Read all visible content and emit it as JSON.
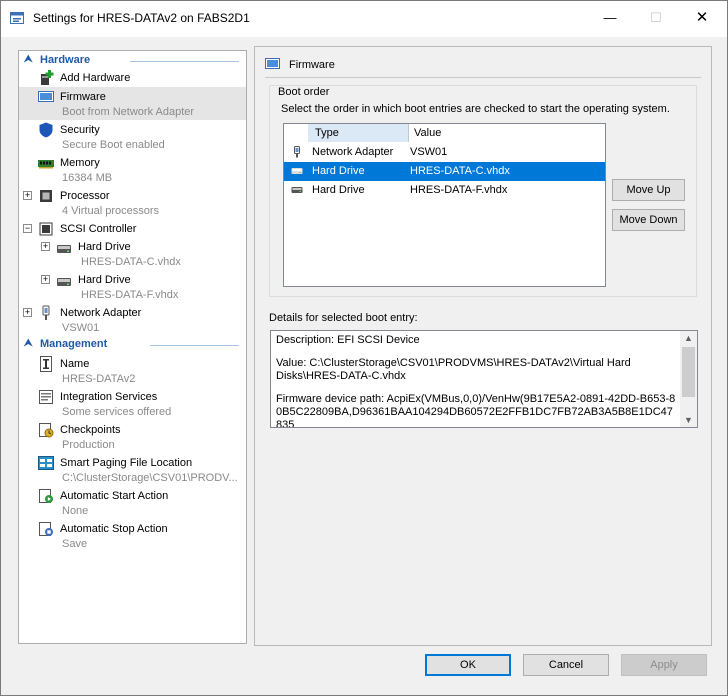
{
  "window": {
    "title": "Settings for HRES-DATAv2 on FABS2D1",
    "minimize_glyph": "—",
    "maximize_glyph": "☐",
    "close_glyph": "✕"
  },
  "sidebar": {
    "hardware_label": "Hardware",
    "management_label": "Management",
    "hardware_items": [
      {
        "name": "Add Hardware",
        "sub": "",
        "icon": "add-hardware-icon"
      },
      {
        "name": "Firmware",
        "sub": "Boot from Network Adapter",
        "icon": "firmware-icon"
      },
      {
        "name": "Security",
        "sub": "Secure Boot enabled",
        "icon": "shield-icon"
      },
      {
        "name": "Memory",
        "sub": "16384 MB",
        "icon": "memory-icon"
      },
      {
        "name": "Processor",
        "sub": "4 Virtual processors",
        "icon": "processor-icon"
      },
      {
        "name": "SCSI Controller",
        "sub": "",
        "icon": "scsi-controller-icon"
      },
      {
        "name": "Hard Drive",
        "sub": "HRES-DATA-C.vhdx",
        "icon": "hard-drive-icon"
      },
      {
        "name": "Hard Drive",
        "sub": "HRES-DATA-F.vhdx",
        "icon": "hard-drive-icon"
      },
      {
        "name": "Network Adapter",
        "sub": "VSW01",
        "icon": "network-adapter-icon"
      }
    ],
    "management_items": [
      {
        "name": "Name",
        "sub": "HRES-DATAv2",
        "icon": "name-icon"
      },
      {
        "name": "Integration Services",
        "sub": "Some services offered",
        "icon": "integration-services-icon"
      },
      {
        "name": "Checkpoints",
        "sub": "Production",
        "icon": "checkpoints-icon"
      },
      {
        "name": "Smart Paging File Location",
        "sub": "C:\\ClusterStorage\\CSV01\\PRODV...",
        "icon": "smart-paging-icon"
      },
      {
        "name": "Automatic Start Action",
        "sub": "None",
        "icon": "auto-start-icon"
      },
      {
        "name": "Automatic Stop Action",
        "sub": "Save",
        "icon": "auto-stop-icon"
      }
    ]
  },
  "firmware": {
    "title": "Firmware",
    "boot_order_label": "Boot order",
    "instruction": "Select the order in which boot entries are checked to start the operating system.",
    "col_type": "Type",
    "col_value": "Value",
    "entries": [
      {
        "type": "Network Adapter",
        "value": "VSW01",
        "icon": "network-adapter-icon"
      },
      {
        "type": "Hard Drive",
        "value": "HRES-DATA-C.vhdx",
        "icon": "hard-drive-icon"
      },
      {
        "type": "Hard Drive",
        "value": "HRES-DATA-F.vhdx",
        "icon": "hard-drive-icon"
      }
    ],
    "move_up_label": "Move Up",
    "move_down_label": "Move Down",
    "details_label": "Details for selected boot entry:",
    "details": {
      "description": "Description: EFI SCSI Device",
      "value": "Value: C:\\ClusterStorage\\CSV01\\PRODVMS\\HRES-DATAv2\\Virtual Hard Disks\\HRES-DATA-C.vhdx",
      "device_path": "Firmware device path: AcpiEx(VMBus,0,0)/VenHw(9B17E5A2-0891-42DD-B653-80B5C22809BA,D96361BAA104294DB60572E2FFB1DC7FB72AB3A5B8E1DC47835"
    }
  },
  "footer": {
    "ok_label": "OK",
    "cancel_label": "Cancel",
    "apply_label": "Apply"
  },
  "colors": {
    "accent": "#0078d7",
    "section_header": "#1e5aa8",
    "selection": "#0078d7",
    "sidebar_selected": "#e5e5e5"
  }
}
